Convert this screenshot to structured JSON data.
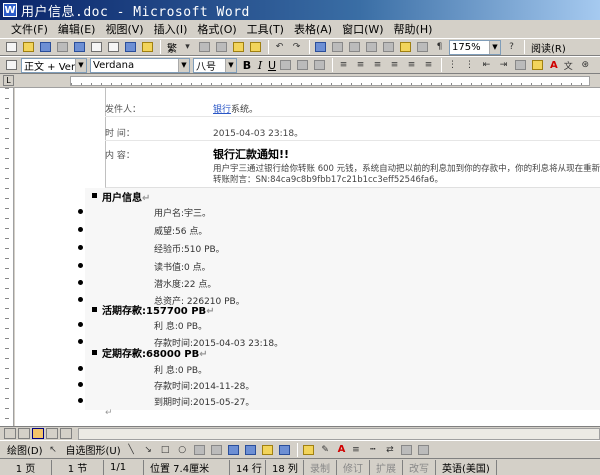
{
  "window": {
    "title": "用户信息.doc - Microsoft Word"
  },
  "menu": [
    "文件(F)",
    "编辑(E)",
    "视图(V)",
    "插入(I)",
    "格式(O)",
    "工具(T)",
    "表格(A)",
    "窗口(W)",
    "帮助(H)"
  ],
  "toolbar": {
    "translate_label": "繁",
    "zoom_value": "175%",
    "read_label": "阅读(R)"
  },
  "format_bar": {
    "style_value": "正文 + Verd",
    "font_value": "Verdana",
    "size_value": "八号",
    "bold": "B",
    "italic": "I",
    "underline": "U",
    "font_color_label": "A"
  },
  "email": {
    "sender_label": "发件人：",
    "sender_value_link": "银行",
    "sender_value_rest": "系统。",
    "time_label": "时  间：",
    "time_value": "2015-04-03 23:18。",
    "content_label": "内  容：",
    "subject": "银行汇款通知!!",
    "body_line1": "用户宇三通过银行给你转账 600 元钱，系统自动把以前的利息加到你的存款中，你的利息将从现在重新开始计算。",
    "body_line2": "转账附言：SN:84ca9c8b9fbb17c21b1cc3eff52546fa6。"
  },
  "doc": {
    "section1_title": "用户信息",
    "user_items": [
      "用户名:宇三。",
      "威望:56 点。",
      "经验币:510 PB。",
      "读书值:0 点。",
      "潜水度:22 点。",
      "总资产: 226210 PB。"
    ],
    "section2_title": "活期存款:157700 PB",
    "current_items": [
      "利  息:0 PB。",
      "存款时间:2015-04-03 23:18。"
    ],
    "section3_title": "定期存款:68000 PB",
    "fixed_items": [
      "利  息:0 PB。",
      "存款时间:2014-11-28。",
      "到期时间:2015-05-27。"
    ],
    "paragraph_mark": "↵"
  },
  "drawing_bar": {
    "draw_label": "绘图(D)",
    "autoshape_label": "自选图形(U)"
  },
  "status": {
    "page": "1 页",
    "section": "1 节",
    "page_of": "1/1",
    "position": "位置 7.4厘米",
    "line": "14 行",
    "column": "18 列",
    "rec": "录制",
    "trk": "修订",
    "ext": "扩展",
    "ovr": "改写",
    "lang": "英语(美国)"
  }
}
